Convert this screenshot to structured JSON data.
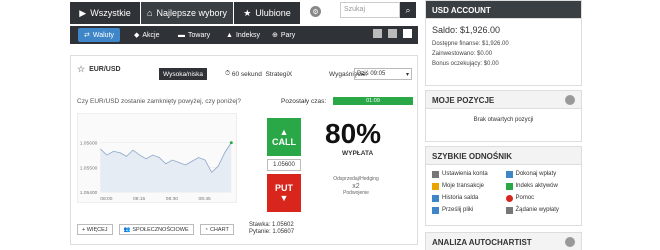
{
  "tabs": {
    "all": "Wszystkie",
    "best": "Najlepsze wybory",
    "favorites": "Ulubione"
  },
  "search": {
    "placeholder": "Szukaj"
  },
  "asset_types": [
    "Waluty",
    "Akcje",
    "Towary",
    "Indeksy",
    "Pary"
  ],
  "trade": {
    "pair": "EUR/USD",
    "mode_high_low": "Wysoka/niska",
    "mode_60s": "60 sekund",
    "mode_strategix": "StrategiX",
    "expiry_label": "Wygaśnięcie:",
    "expiry_value": "Dziś 09:05",
    "question": "Czy EUR/USD zostanie zamknięty powyżej, czy poniżej?",
    "remaining_label": "Pozostały czas:",
    "remaining_value": "01:09",
    "call_label": "CALL",
    "put_label": "PUT",
    "strike_value": "1.05600",
    "current_rate": "1.05600",
    "payout_pct": "80%",
    "payout_label": "WYPŁATA",
    "hedge_label": "Odsprzedaj/Hedging",
    "double_label": "x2",
    "double_sub": "Podwojenie",
    "more_button": "+ WIĘCEJ",
    "social_button": "SPOŁECZNOŚCIOWE",
    "chart_button": "CHART",
    "stake_label": "Stawka: 1.05602",
    "ask_label": "Pytanie: 1.05607"
  },
  "chart_data": {
    "type": "line",
    "x": [
      "08:00",
      "08:15",
      "08:30",
      "08:45"
    ],
    "ylim": [
      1.054,
      1.057
    ],
    "y_ticks": [
      "1.05600",
      "1.05500",
      "1.05400"
    ],
    "series": [
      {
        "values": [
          1.05575,
          1.0555,
          1.05565,
          1.0556,
          1.05545,
          1.0557,
          1.0555,
          1.05535,
          1.0555,
          1.0554,
          1.05515,
          1.0553,
          1.0552,
          1.0551,
          1.05525,
          1.0554,
          1.0553,
          1.0548,
          1.05505,
          1.0556,
          1.056
        ]
      }
    ]
  },
  "account": {
    "title": "USD ACCOUNT",
    "balance": "Saldo: $1,926.00",
    "available": "Dostępne finanse: $1,926.00",
    "locked": "Zainwestowano: $0.00",
    "bonus": "Bonus oczekujący: $0.00"
  },
  "positions": {
    "title": "MOJE POZYCJE",
    "empty": "Brak otwartych pozycji"
  },
  "quicklinks": {
    "title": "SZYBKIE ODNOŚNIK",
    "items": [
      "Ustawienia konta",
      "Dokonaj wpłaty",
      "Moje transakcje",
      "Indeks aktywów",
      "Historia salda",
      "Pomoc",
      "Prześlij pliki",
      "Żądanie wypłaty"
    ]
  },
  "autochartist": {
    "title": "ANALIZA AUTOCHARTIST"
  }
}
